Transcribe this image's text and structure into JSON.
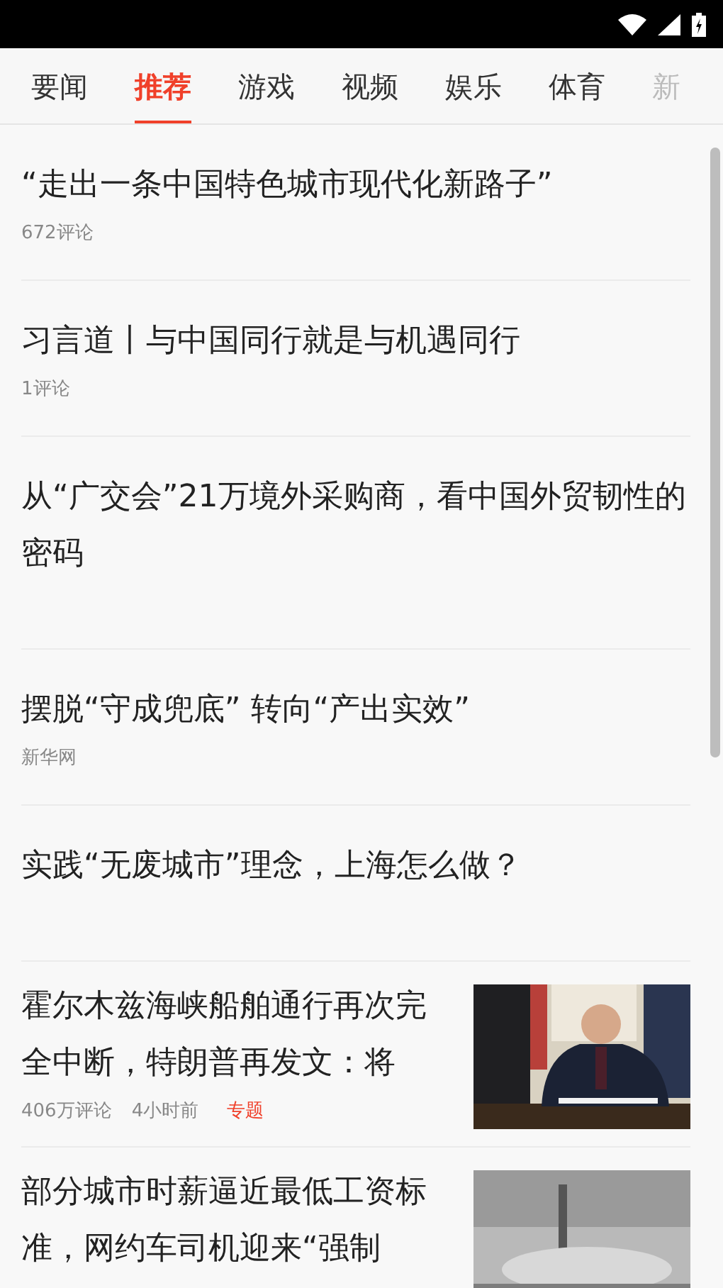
{
  "tabs": [
    {
      "label": "要闻",
      "selected": false
    },
    {
      "label": "推荐",
      "selected": true
    },
    {
      "label": "游戏",
      "selected": false
    },
    {
      "label": "视频",
      "selected": false
    },
    {
      "label": "娱乐",
      "selected": false
    },
    {
      "label": "体育",
      "selected": false
    },
    {
      "label": "新",
      "selected": false
    }
  ],
  "articles": [
    {
      "kind": "text",
      "title": "“走出一条中国特色城市现代化新路子”",
      "meta": [
        {
          "kind": "plain",
          "text": "672评论"
        }
      ]
    },
    {
      "kind": "text",
      "title": "习言道丨与中国同行就是与机遇同行",
      "meta": [
        {
          "kind": "plain",
          "text": "1评论"
        }
      ]
    },
    {
      "kind": "text",
      "title": "从“广交会”21万境外采购商，看中国外贸韧性的密码"
    },
    {
      "kind": "text",
      "title": "摆脱“守成兜底” 转向“产出实效”",
      "meta": [
        {
          "kind": "plain",
          "text": "新华网"
        }
      ]
    },
    {
      "kind": "text",
      "title": "实践“无废城市”理念，上海怎么做？"
    },
    {
      "title": "霍尔木兹海峡船舶通行再次完全中断，特朗普再发文：将",
      "meta": [
        {
          "kind": "plain",
          "text": "406万评论"
        },
        {
          "kind": "plain",
          "text": "4小时前"
        },
        {
          "kind": "tag",
          "text": "专题"
        }
      ]
    },
    {
      "title": "部分城市时薪逼近最低工资标准，网约车司机迎来“强制"
    }
  ]
}
